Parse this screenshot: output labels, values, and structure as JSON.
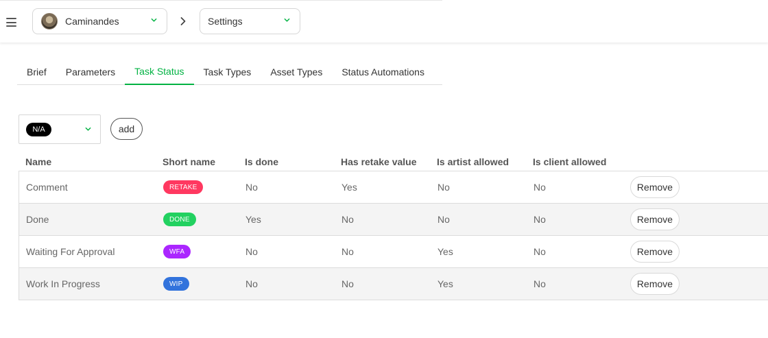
{
  "header": {
    "production": {
      "label": "Caminandes",
      "icon": "production-avatar"
    },
    "separator_icon": "chevron-right-icon",
    "section": {
      "label": "Settings"
    }
  },
  "tabs": [
    {
      "label": "Brief",
      "active": false
    },
    {
      "label": "Parameters",
      "active": false
    },
    {
      "label": "Task Status",
      "active": true
    },
    {
      "label": "Task Types",
      "active": false
    },
    {
      "label": "Asset Types",
      "active": false
    },
    {
      "label": "Status Automations",
      "active": false
    }
  ],
  "filter": {
    "selected_status": "N/A",
    "add_label": "add"
  },
  "table": {
    "headers": {
      "name": "Name",
      "short_name": "Short name",
      "is_done": "Is done",
      "has_retake": "Has retake value",
      "is_artist_allowed": "Is artist allowed",
      "is_client_allowed": "Is client allowed"
    },
    "rows": [
      {
        "name": "Comment",
        "short_name": "RETAKE",
        "color": "#ff3860",
        "is_done": "No",
        "has_retake": "Yes",
        "is_artist_allowed": "No",
        "is_client_allowed": "No",
        "action": "Remove"
      },
      {
        "name": "Done",
        "short_name": "DONE",
        "color": "#22d160",
        "is_done": "Yes",
        "has_retake": "No",
        "is_artist_allowed": "No",
        "is_client_allowed": "No",
        "action": "Remove"
      },
      {
        "name": "Waiting For Approval",
        "short_name": "WFA",
        "color": "#ab26ff",
        "is_done": "No",
        "has_retake": "No",
        "is_artist_allowed": "Yes",
        "is_client_allowed": "No",
        "action": "Remove"
      },
      {
        "name": "Work In Progress",
        "short_name": "WIP",
        "color": "#3273dc",
        "is_done": "No",
        "has_retake": "No",
        "is_artist_allowed": "Yes",
        "is_client_allowed": "No",
        "action": "Remove"
      }
    ]
  },
  "colors": {
    "accent": "#00b242",
    "na_badge": "#000000"
  }
}
